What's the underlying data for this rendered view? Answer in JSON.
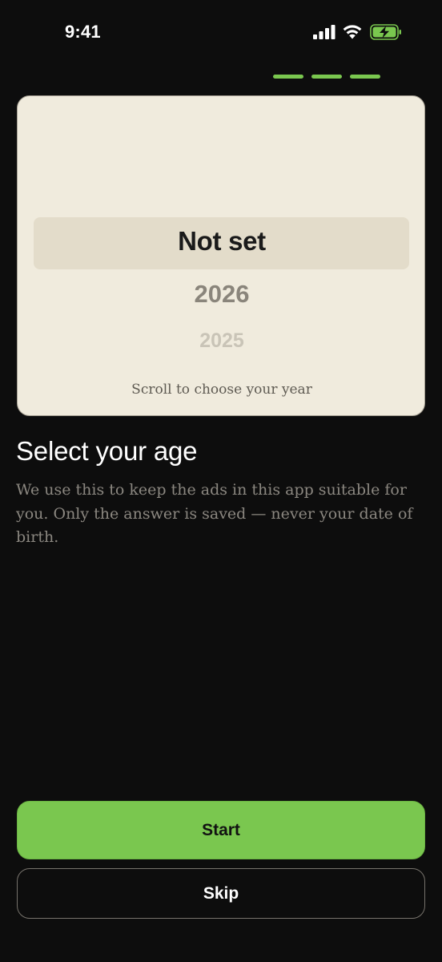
{
  "status_bar": {
    "time": "9:41",
    "signal_icon": "cellular-signal-icon",
    "wifi_icon": "wifi-icon",
    "battery_icon": "battery-charging-icon"
  },
  "progress": {
    "total_steps": 3,
    "completed_steps": 3,
    "color": "#7ac74f"
  },
  "picker": {
    "options": [
      "Not set",
      "2026",
      "2025"
    ],
    "selected": "Not set",
    "hint": "Scroll to choose your year"
  },
  "content": {
    "title": "Select your age",
    "description": "We use this to keep the ads in this app suitable for you. Only the answer is saved — never your date of birth."
  },
  "buttons": {
    "start_label": "Start",
    "skip_label": "Skip"
  },
  "colors": {
    "accent": "#7ac74f",
    "background": "#0d0d0d",
    "card": "#f0ebdd"
  }
}
